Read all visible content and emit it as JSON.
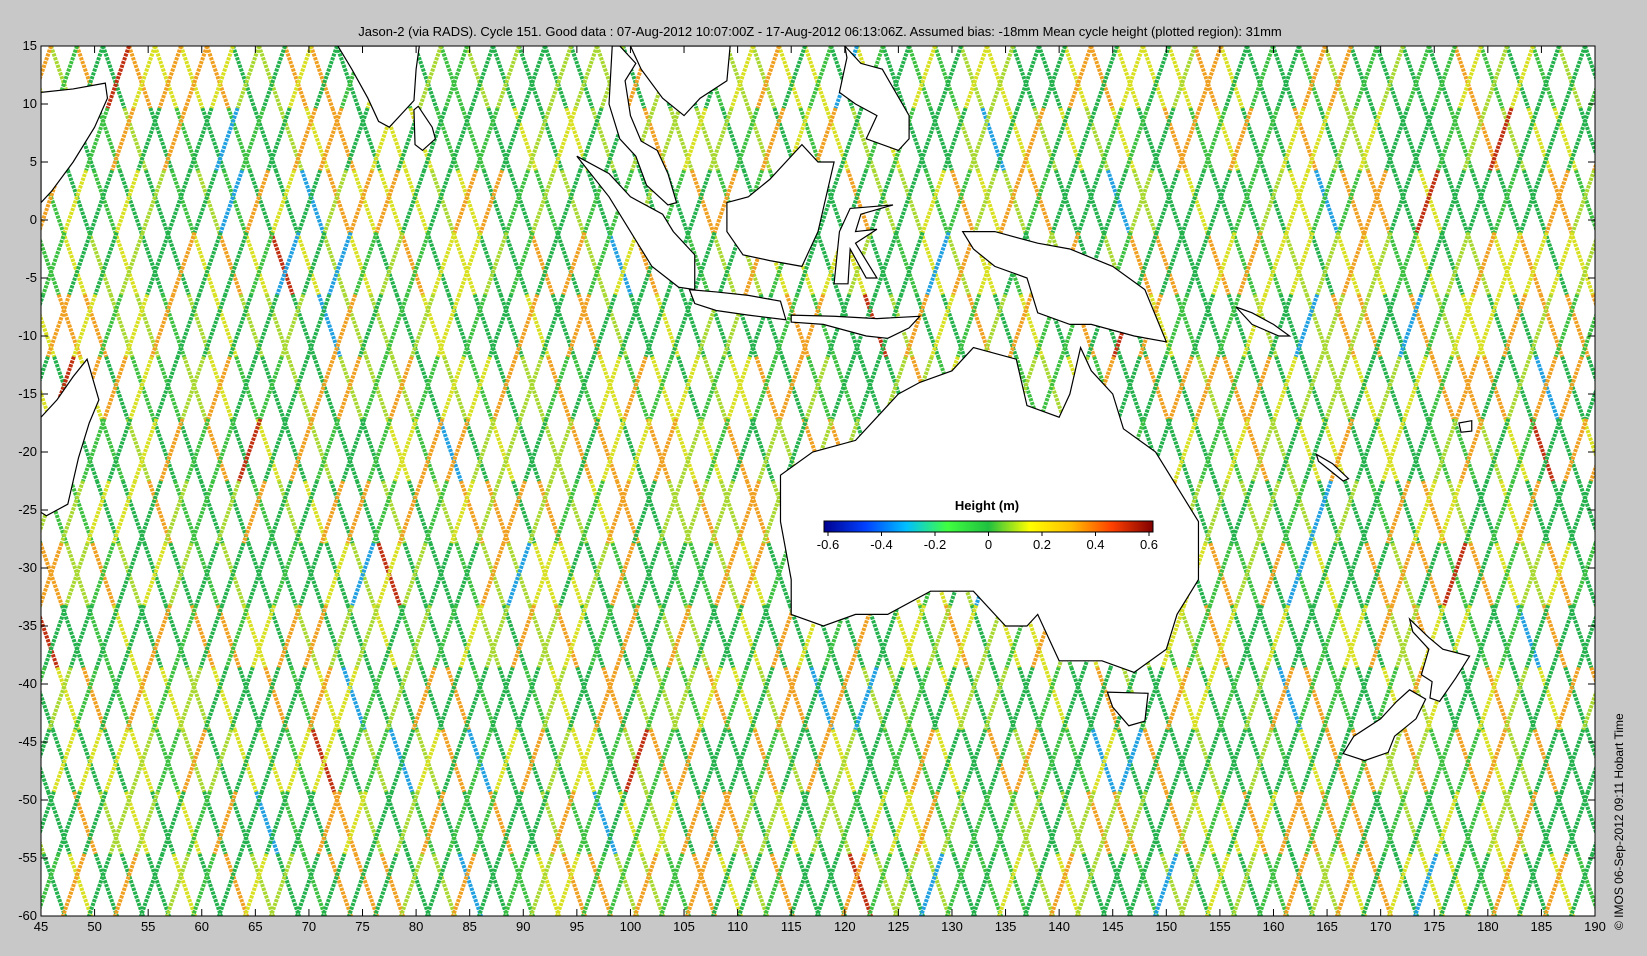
{
  "figure": {
    "title": "Jason-2 (via RADS). Cycle 151. Good data : 07-Aug-2012 10:07:00Z - 17-Aug-2012 06:13:06Z. Assumed bias: -18mm  Mean cycle height (plotted region): 31mm",
    "credit": "© IMOS 06-Sep-2012 09:11 Hobart Time"
  },
  "map": {
    "lon_range": [
      45,
      190
    ],
    "lat_range": [
      -60,
      15
    ],
    "x_ticks": [
      "45",
      "50",
      "55",
      "60",
      "65",
      "70",
      "75",
      "80",
      "85",
      "90",
      "95",
      "100",
      "105",
      "110",
      "115",
      "120",
      "125",
      "130",
      "135",
      "140",
      "145",
      "150",
      "155",
      "160",
      "165",
      "170",
      "175",
      "180",
      "185",
      "190"
    ],
    "y_ticks": [
      "15",
      "10",
      "5",
      "0",
      "-5",
      "-10",
      "-15",
      "-20",
      "-25",
      "-30",
      "-35",
      "-40",
      "-45",
      "-50",
      "-55",
      "-60"
    ],
    "track_count_note_hidden": ""
  },
  "colorbar": {
    "label": "Height (m)",
    "ticks": [
      "-0.6",
      "-0.4",
      "-0.2",
      "0",
      "0.2",
      "0.4",
      "0.6"
    ],
    "colors": [
      "#00008f",
      "#0040ff",
      "#00bfff",
      "#40ff40",
      "#20c040",
      "#ffff00",
      "#ffbf00",
      "#ff4000",
      "#800000"
    ]
  },
  "colors": {
    "background": "#c8c8c8",
    "plot_background": "#ffffff",
    "coast": "#000000",
    "track_green": "#22b14c",
    "track_yellow": "#d8e020",
    "track_orange": "#f0a020"
  },
  "land": [
    {
      "name": "Australia",
      "points": [
        [
          114,
          -22
        ],
        [
          114,
          -26
        ],
        [
          115,
          -31
        ],
        [
          115,
          -34
        ],
        [
          118,
          -35
        ],
        [
          121,
          -34
        ],
        [
          124,
          -34
        ],
        [
          128,
          -32
        ],
        [
          132,
          -32
        ],
        [
          135,
          -35
        ],
        [
          137,
          -35
        ],
        [
          138,
          -34
        ],
        [
          140,
          -38
        ],
        [
          144,
          -38
        ],
        [
          147,
          -39
        ],
        [
          150,
          -37
        ],
        [
          151,
          -34
        ],
        [
          153,
          -31
        ],
        [
          153,
          -26
        ],
        [
          151,
          -23
        ],
        [
          149,
          -20
        ],
        [
          146,
          -18
        ],
        [
          145,
          -15
        ],
        [
          143,
          -13
        ],
        [
          142,
          -11
        ],
        [
          141,
          -15
        ],
        [
          140,
          -17
        ],
        [
          137,
          -16
        ],
        [
          136,
          -12
        ],
        [
          132,
          -11
        ],
        [
          130,
          -13
        ],
        [
          127,
          -14
        ],
        [
          125,
          -15
        ],
        [
          123,
          -17
        ],
        [
          121,
          -19
        ],
        [
          117,
          -20
        ]
      ]
    },
    {
      "name": "Tasmania",
      "points": [
        [
          144.5,
          -40.7
        ],
        [
          148.3,
          -40.8
        ],
        [
          148,
          -43.2
        ],
        [
          146.5,
          -43.6
        ],
        [
          145,
          -42
        ]
      ]
    },
    {
      "name": "New Guinea",
      "points": [
        [
          131,
          -1
        ],
        [
          134,
          -1
        ],
        [
          138,
          -2
        ],
        [
          141,
          -2.5
        ],
        [
          145,
          -4
        ],
        [
          148,
          -6
        ],
        [
          150,
          -10.5
        ],
        [
          147,
          -10
        ],
        [
          143,
          -9
        ],
        [
          141,
          -9
        ],
        [
          138,
          -8
        ],
        [
          137,
          -5
        ],
        [
          134,
          -4
        ],
        [
          132,
          -2.5
        ]
      ]
    },
    {
      "name": "Borneo",
      "points": [
        [
          109,
          1.5
        ],
        [
          111,
          2
        ],
        [
          113,
          3.5
        ],
        [
          116,
          6.5
        ],
        [
          117.5,
          5
        ],
        [
          119,
          5
        ],
        [
          118,
          1
        ],
        [
          117.5,
          -1
        ],
        [
          116,
          -4
        ],
        [
          113,
          -3.5
        ],
        [
          110.5,
          -3
        ],
        [
          109,
          -1
        ]
      ]
    },
    {
      "name": "Sumatra",
      "points": [
        [
          95,
          5.5
        ],
        [
          98,
          4
        ],
        [
          100,
          2
        ],
        [
          103,
          0.5
        ],
        [
          104,
          -1
        ],
        [
          106,
          -3
        ],
        [
          106,
          -6
        ],
        [
          104.5,
          -5.8
        ],
        [
          102,
          -4
        ],
        [
          100,
          -1
        ],
        [
          98,
          2
        ]
      ]
    },
    {
      "name": "Java",
      "points": [
        [
          105.5,
          -6
        ],
        [
          108,
          -6.2
        ],
        [
          111,
          -6.5
        ],
        [
          114,
          -7
        ],
        [
          114.5,
          -8.6
        ],
        [
          111,
          -8.2
        ],
        [
          108,
          -7.8
        ],
        [
          106,
          -7.2
        ]
      ]
    },
    {
      "name": "Sulawesi",
      "points": [
        [
          119,
          -5.5
        ],
        [
          119.5,
          -1
        ],
        [
          120.5,
          1
        ],
        [
          124.5,
          1.3
        ],
        [
          121.5,
          0.5
        ],
        [
          121,
          -1
        ],
        [
          123,
          -0.8
        ],
        [
          121,
          -2
        ],
        [
          123,
          -5
        ],
        [
          122,
          -5
        ],
        [
          120.5,
          -2.5
        ],
        [
          120.3,
          -5.5
        ]
      ]
    },
    {
      "name": "Lesser Sunda",
      "points": [
        [
          115,
          -8.2
        ],
        [
          119,
          -8.3
        ],
        [
          123,
          -8.5
        ],
        [
          127,
          -8.3
        ],
        [
          126,
          -9.3
        ],
        [
          124,
          -10.2
        ],
        [
          122,
          -10
        ],
        [
          118,
          -9
        ],
        [
          115,
          -8.8
        ]
      ]
    },
    {
      "name": "Malay Peninsula",
      "points": [
        [
          98,
          10
        ],
        [
          99,
          7
        ],
        [
          100.5,
          5.5
        ],
        [
          101.5,
          3
        ],
        [
          103.5,
          1.3
        ],
        [
          104.3,
          1.5
        ],
        [
          103.5,
          4
        ],
        [
          102.5,
          6
        ],
        [
          101,
          6.8
        ],
        [
          100,
          9
        ],
        [
          99.5,
          12
        ],
        [
          100.5,
          13.5
        ],
        [
          99,
          15
        ],
        [
          98.3,
          15
        ]
      ]
    },
    {
      "name": "Indochina",
      "points": [
        [
          100,
          15
        ],
        [
          101,
          13
        ],
        [
          103,
          10.5
        ],
        [
          105,
          9
        ],
        [
          106.5,
          10.5
        ],
        [
          109,
          12
        ],
        [
          109.3,
          15
        ],
        [
          108,
          15
        ]
      ]
    },
    {
      "name": "Philippines",
      "points": [
        [
          120,
          15
        ],
        [
          121.5,
          13.5
        ],
        [
          123.5,
          13
        ],
        [
          126,
          9
        ],
        [
          126,
          7
        ],
        [
          125,
          6
        ],
        [
          122,
          7
        ],
        [
          123,
          9
        ],
        [
          121,
          10
        ],
        [
          119.5,
          11
        ],
        [
          120.2,
          14
        ]
      ]
    },
    {
      "name": "India",
      "points": [
        [
          72.7,
          15
        ],
        [
          74,
          13
        ],
        [
          75.5,
          10.5
        ],
        [
          76.5,
          8.5
        ],
        [
          77.5,
          8
        ],
        [
          78.5,
          9
        ],
        [
          79.8,
          10.3
        ],
        [
          80,
          13
        ],
        [
          80.3,
          15
        ]
      ]
    },
    {
      "name": "Sri Lanka",
      "points": [
        [
          79.8,
          9.5
        ],
        [
          80.2,
          9.8
        ],
        [
          81.5,
          8
        ],
        [
          81.8,
          7
        ],
        [
          80.6,
          6
        ],
        [
          79.9,
          6.5
        ]
      ]
    },
    {
      "name": "Africa Horn",
      "points": [
        [
          45,
          11
        ],
        [
          48,
          11.3
        ],
        [
          51,
          11.8
        ],
        [
          51.2,
          10.5
        ],
        [
          50,
          8
        ],
        [
          48,
          5
        ],
        [
          46,
          2.5
        ],
        [
          45,
          1.5
        ]
      ]
    },
    {
      "name": "Madagascar",
      "points": [
        [
          49.3,
          -12
        ],
        [
          50.4,
          -15.5
        ],
        [
          49.5,
          -17.5
        ],
        [
          48.5,
          -20.5
        ],
        [
          47.5,
          -24.5
        ],
        [
          45.5,
          -25.5
        ],
        [
          45,
          -25.2
        ],
        [
          45,
          -17
        ],
        [
          46.5,
          -15.5
        ],
        [
          48,
          -13.5
        ]
      ]
    },
    {
      "name": "NZ North",
      "points": [
        [
          172.7,
          -34.4
        ],
        [
          174.5,
          -36
        ],
        [
          175.8,
          -37
        ],
        [
          178.3,
          -37.6
        ],
        [
          177,
          -39.5
        ],
        [
          175.5,
          -41.5
        ],
        [
          174.6,
          -41.2
        ],
        [
          174.8,
          -39.8
        ],
        [
          173.8,
          -39.2
        ],
        [
          174.5,
          -37
        ],
        [
          173,
          -35.5
        ]
      ]
    },
    {
      "name": "NZ South",
      "points": [
        [
          172.7,
          -40.5
        ],
        [
          174.2,
          -41.3
        ],
        [
          173.3,
          -43
        ],
        [
          171.3,
          -44.5
        ],
        [
          170.7,
          -45.9
        ],
        [
          168.5,
          -46.6
        ],
        [
          166.5,
          -46
        ],
        [
          167.5,
          -44.5
        ],
        [
          170,
          -43
        ],
        [
          171.5,
          -41.5
        ]
      ]
    },
    {
      "name": "New Caledonia",
      "points": [
        [
          164,
          -20.2
        ],
        [
          165.5,
          -21
        ],
        [
          167,
          -22.3
        ],
        [
          166.5,
          -22.5
        ],
        [
          164.2,
          -20.8
        ]
      ]
    },
    {
      "name": "Fiji",
      "points": [
        [
          177.3,
          -17.5
        ],
        [
          178.5,
          -17.3
        ],
        [
          178.5,
          -18.2
        ],
        [
          177.5,
          -18.3
        ]
      ]
    },
    {
      "name": "Solomons",
      "points": [
        [
          156.5,
          -7.5
        ],
        [
          158,
          -8
        ],
        [
          160,
          -9
        ],
        [
          161.5,
          -10
        ],
        [
          160.5,
          -10
        ],
        [
          158,
          -9
        ]
      ]
    }
  ]
}
